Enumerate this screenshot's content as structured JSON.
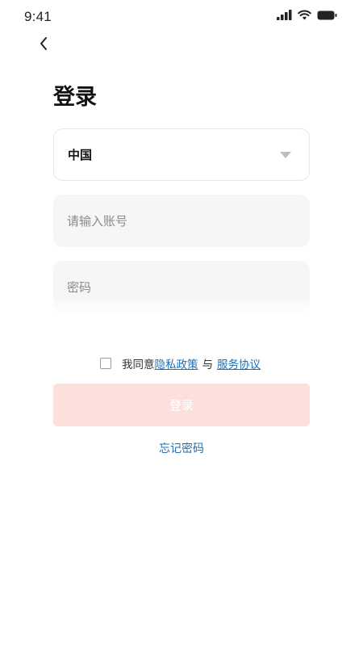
{
  "status_bar": {
    "time": "9:41"
  },
  "icons": {
    "back": "chevron-left-icon",
    "signal": "signal-icon",
    "wifi": "wifi-icon",
    "battery": "battery-icon",
    "caret": "caret-down-icon"
  },
  "page": {
    "title": "登录"
  },
  "form": {
    "country": {
      "value": "中国"
    },
    "account": {
      "value": "",
      "placeholder": "请输入账号"
    },
    "password": {
      "value": "",
      "placeholder": "密码"
    }
  },
  "agreement": {
    "prefix": "我同意",
    "privacy_link": "隐私政策",
    "separator": "与",
    "terms_link": "服务协议",
    "checked": false
  },
  "actions": {
    "login_label": "登录",
    "forgot_label": "忘记密码"
  },
  "colors": {
    "link": "#1f6fb8",
    "login_button_bg": "#fde0dc",
    "field_bg": "#f6f6f6"
  }
}
